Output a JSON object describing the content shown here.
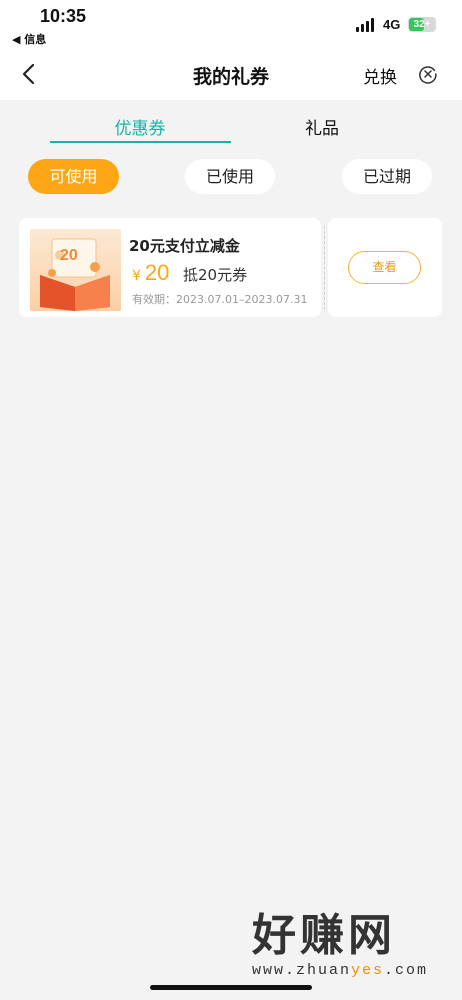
{
  "status_bar": {
    "time": "10:35",
    "back_app": "◀ 信息",
    "network": "4G",
    "battery": "32+"
  },
  "nav": {
    "title": "我的礼券",
    "redeem": "兑换",
    "icons": {
      "back": "chevron-left-icon",
      "close": "close-circle-icon"
    }
  },
  "tabs": [
    {
      "label": "优惠券",
      "active": true
    },
    {
      "label": "礼品",
      "active": false
    }
  ],
  "filters": [
    {
      "label": "可使用",
      "active": true
    },
    {
      "label": "已使用",
      "active": false
    },
    {
      "label": "已过期",
      "active": false
    }
  ],
  "coupons": [
    {
      "title": "20元支付立减金",
      "currency": "¥",
      "amount": "20",
      "deduct": "抵20元券",
      "validity": "有效期：2023.07.01–2023.07.31",
      "view_label": "查看",
      "image_text": "20"
    }
  ],
  "watermark": {
    "text": "好赚网",
    "url_pre": "www.zhuan",
    "url_hl": "yes",
    "url_post": ".com"
  },
  "colors": {
    "accent": "#17b3a8",
    "orange": "#ffa615",
    "background": "#f3f3f3"
  }
}
